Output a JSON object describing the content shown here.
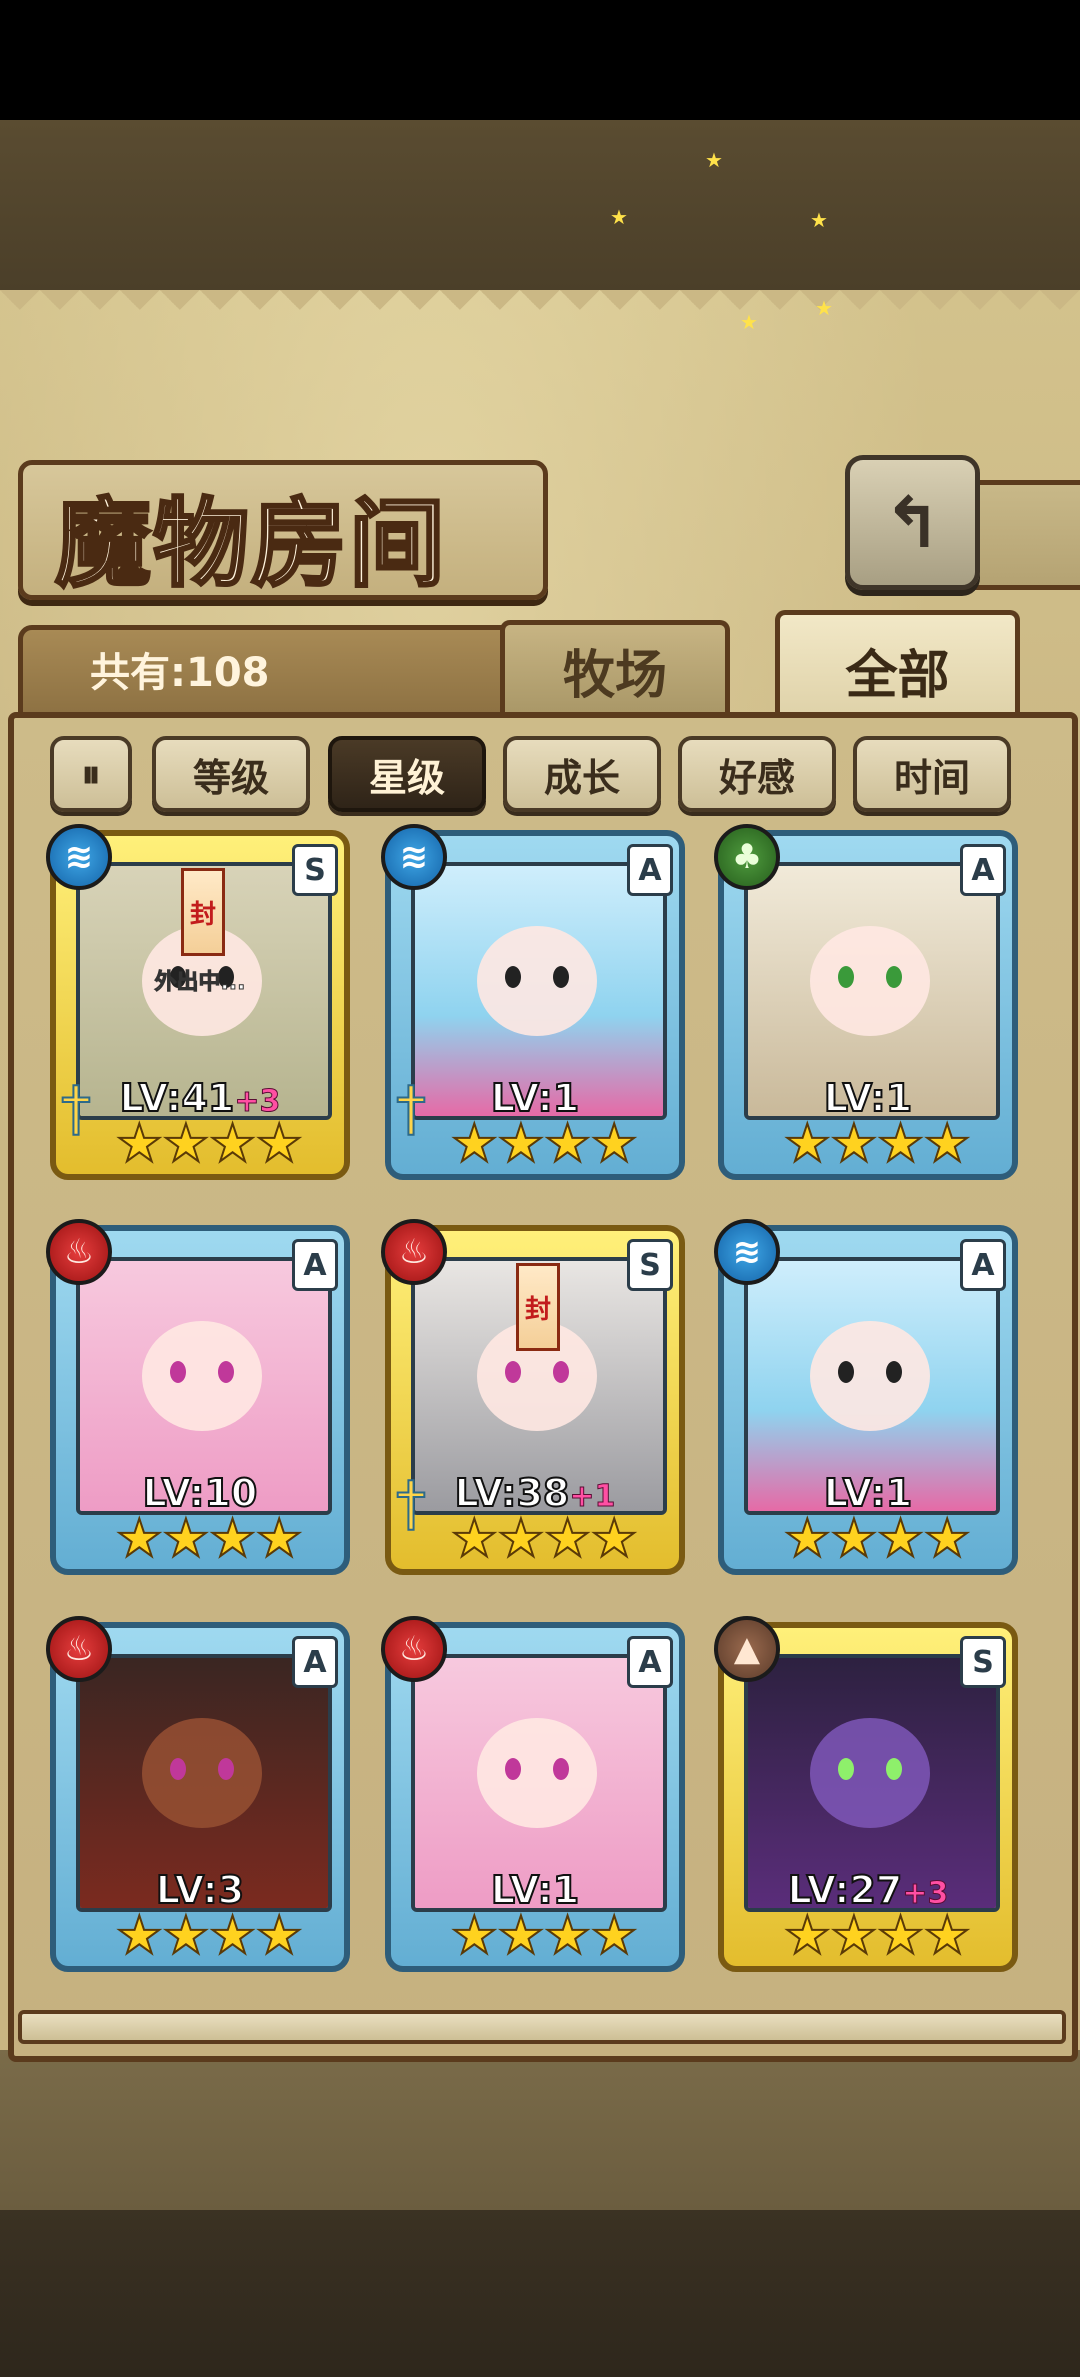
{
  "header": {
    "title": "魔物房间",
    "back_icon": "back-arrow-icon"
  },
  "collection": {
    "count_text": "共有:108"
  },
  "tabs": [
    {
      "label": "牧场",
      "active": false
    },
    {
      "label": "全部",
      "active": true
    }
  ],
  "sort": {
    "toggle_icon": "sort-toggle-icon",
    "buttons": [
      {
        "label": "等级",
        "active": false
      },
      {
        "label": "星级",
        "active": true
      },
      {
        "label": "成长",
        "active": false
      },
      {
        "label": "好感",
        "active": false
      },
      {
        "label": "时间",
        "active": false
      }
    ]
  },
  "monsters": [
    {
      "element": "water",
      "element_glyph": "≋",
      "rank": "S",
      "level": "LV:41",
      "bonus": "+3",
      "stars": 4,
      "frame": "gold",
      "status": "外出中...",
      "sealed": true,
      "weapon": true
    },
    {
      "element": "water",
      "element_glyph": "≋",
      "rank": "A",
      "level": "LV:1",
      "bonus": "",
      "stars": 4,
      "frame": "blue",
      "status": "",
      "sealed": false,
      "weapon": true
    },
    {
      "element": "grass",
      "element_glyph": "♣",
      "rank": "A",
      "level": "LV:1",
      "bonus": "",
      "stars": 4,
      "frame": "blue",
      "status": "",
      "sealed": false,
      "weapon": false
    },
    {
      "element": "fire",
      "element_glyph": "♨",
      "rank": "A",
      "level": "LV:10",
      "bonus": "",
      "stars": 4,
      "frame": "blue",
      "status": "",
      "sealed": false,
      "weapon": false
    },
    {
      "element": "fire",
      "element_glyph": "♨",
      "rank": "S",
      "level": "LV:38",
      "bonus": "+1",
      "stars": 4,
      "frame": "gold",
      "status": "",
      "sealed": true,
      "weapon": true
    },
    {
      "element": "water",
      "element_glyph": "≋",
      "rank": "A",
      "level": "LV:1",
      "bonus": "",
      "stars": 4,
      "frame": "blue",
      "status": "",
      "sealed": false,
      "weapon": false
    },
    {
      "element": "fire",
      "element_glyph": "♨",
      "rank": "A",
      "level": "LV:3",
      "bonus": "",
      "stars": 4,
      "frame": "blue",
      "status": "",
      "sealed": false,
      "weapon": false
    },
    {
      "element": "fire",
      "element_glyph": "♨",
      "rank": "A",
      "level": "LV:1",
      "bonus": "",
      "stars": 4,
      "frame": "blue",
      "status": "",
      "sealed": false,
      "weapon": false
    },
    {
      "element": "earth",
      "element_glyph": "▲",
      "rank": "S",
      "level": "LV:27",
      "bonus": "+3",
      "stars": 4,
      "frame": "gold",
      "status": "",
      "sealed": false,
      "weapon": false
    }
  ],
  "colors": {
    "parchment": "#cbb885",
    "frame_brown": "#5b3b1d",
    "card_blue": "#63aed3",
    "card_gold": "#e3bd2d",
    "bonus_pink": "#ff4fa3",
    "star_yellow": "#ffd21f"
  },
  "seal_glyph": "封"
}
